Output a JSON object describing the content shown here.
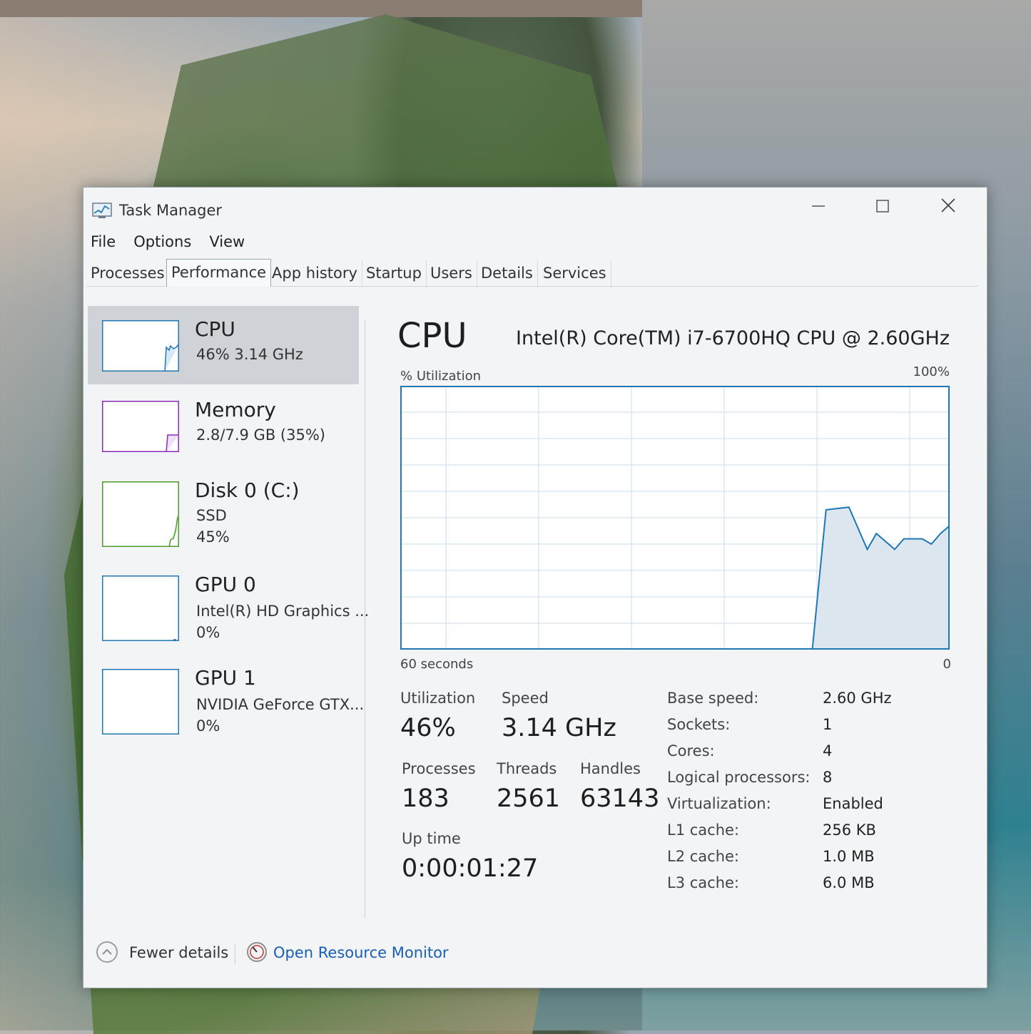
{
  "window": {
    "title": "Task Manager"
  },
  "menu": [
    "File",
    "Options",
    "View"
  ],
  "tabs": [
    "Processes",
    "Performance",
    "App history",
    "Startup",
    "Users",
    "Details",
    "Services"
  ],
  "active_tab": "Performance",
  "sidebar": {
    "cpu": {
      "title": "CPU",
      "line1": "46% 3.14 GHz"
    },
    "memory": {
      "title": "Memory",
      "line1": "2.8/7.9 GB (35%)"
    },
    "disk": {
      "title": "Disk 0 (C:)",
      "line1": "SSD",
      "line2": "45%"
    },
    "gpu0": {
      "title": "GPU 0",
      "line1": "Intel(R) HD Graphics ...",
      "line2": "0%"
    },
    "gpu1": {
      "title": "GPU 1",
      "line1": "NVIDIA GeForce GTX...",
      "line2": "0%"
    }
  },
  "main": {
    "title": "CPU",
    "model": "Intel(R) Core(TM) i7-6700HQ CPU @ 2.60GHz",
    "util_label": "% Utilization",
    "util_max": "100%",
    "time_label": "60 seconds",
    "time_zero": "0"
  },
  "chart_data": {
    "type": "area",
    "xlabel": "60 seconds",
    "ylabel": "% Utilization",
    "xlim": [
      60,
      0
    ],
    "ylim": [
      0,
      100
    ],
    "grid": true,
    "x": [
      60,
      15,
      13.5,
      11,
      9.5,
      9,
      8,
      7,
      6,
      5,
      4,
      3,
      2,
      1.5,
      1,
      0
    ],
    "values": [
      0,
      0,
      53,
      54,
      42,
      38,
      44,
      41,
      38,
      42,
      42,
      42,
      40,
      42,
      44,
      47
    ]
  },
  "stats": {
    "utilization": {
      "label": "Utilization",
      "value": "46%"
    },
    "speed": {
      "label": "Speed",
      "value": "3.14 GHz"
    },
    "processes": {
      "label": "Processes",
      "value": "183"
    },
    "threads": {
      "label": "Threads",
      "value": "2561"
    },
    "handles": {
      "label": "Handles",
      "value": "63143"
    },
    "uptime": {
      "label": "Up time",
      "value": "0:00:01:27"
    }
  },
  "specs": [
    {
      "key": "Base speed:",
      "value": "2.60 GHz"
    },
    {
      "key": "Sockets:",
      "value": "1"
    },
    {
      "key": "Cores:",
      "value": "4"
    },
    {
      "key": "Logical processors:",
      "value": "8"
    },
    {
      "key": "Virtualization:",
      "value": "Enabled"
    },
    {
      "key": "L1 cache:",
      "value": "256 KB"
    },
    {
      "key": "L2 cache:",
      "value": "1.0 MB"
    },
    {
      "key": "L3 cache:",
      "value": "6.0 MB"
    }
  ],
  "footer": {
    "fewer_details": "Fewer details",
    "open_monitor": "Open Resource Monitor"
  },
  "colors": {
    "cpu": "#1f78b4",
    "memory": "#8b2bb9",
    "disk": "#4d9a2a",
    "gpu": "#1f78b4",
    "link": "#1a5fb4"
  }
}
